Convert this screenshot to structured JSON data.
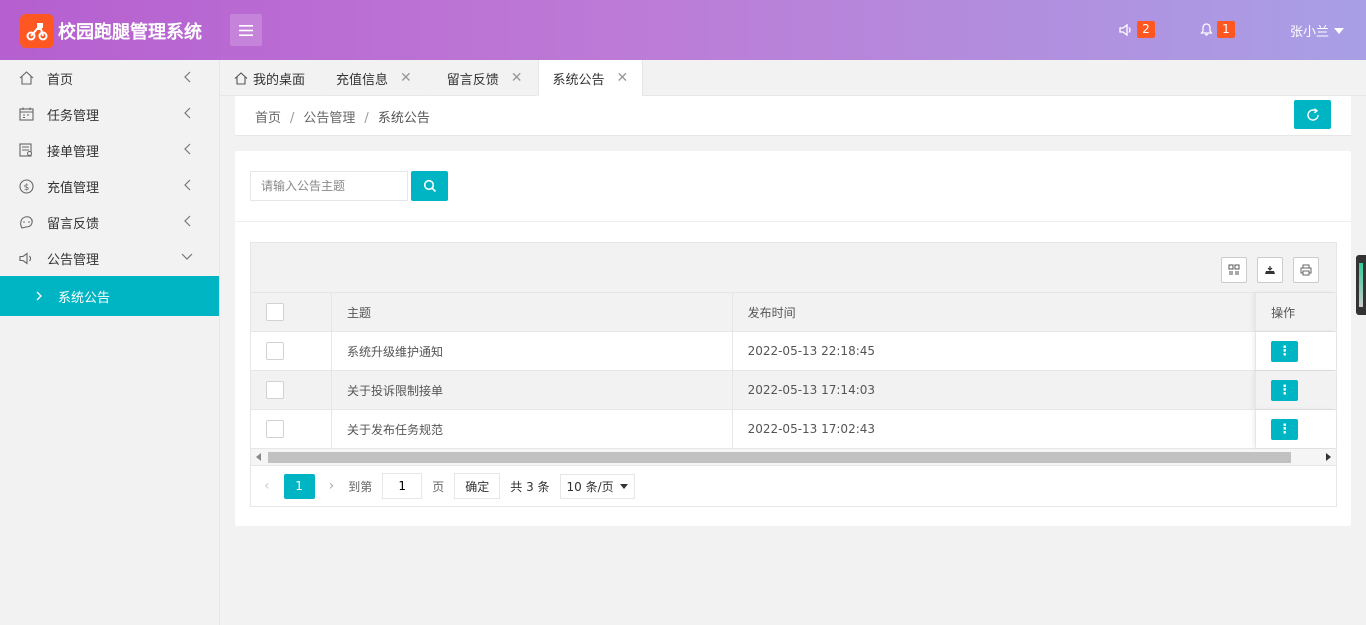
{
  "app": {
    "title": "校园跑腿管理系统",
    "brand_color": "#ff5722",
    "accent": "#00b5c3"
  },
  "header": {
    "notice_count": "2",
    "bell_count": "1",
    "user_name": "张小兰"
  },
  "sidebar": {
    "items": [
      {
        "label": "首页",
        "icon": "home-icon"
      },
      {
        "label": "任务管理",
        "icon": "calendar-icon"
      },
      {
        "label": "接单管理",
        "icon": "order-icon"
      },
      {
        "label": "充值管理",
        "icon": "dollar-icon"
      },
      {
        "label": "留言反馈",
        "icon": "message-icon"
      },
      {
        "label": "公告管理",
        "icon": "speaker-icon"
      }
    ],
    "active_sub": "系统公告"
  },
  "tabs": [
    {
      "label": "我的桌面"
    },
    {
      "label": "充值信息"
    },
    {
      "label": "留言反馈"
    },
    {
      "label": "系统公告"
    }
  ],
  "breadcrumb": [
    "首页",
    "公告管理",
    "系统公告"
  ],
  "search": {
    "placeholder": "请输入公告主题",
    "value": ""
  },
  "table": {
    "headers": {
      "subject": "主题",
      "time": "发布时间",
      "op": "操作"
    },
    "rows": [
      {
        "subject": "系统升级维护通知",
        "time": "2022-05-13 22:18:45"
      },
      {
        "subject": "关于投诉限制接单",
        "time": "2022-05-13 17:14:03"
      },
      {
        "subject": "关于发布任务规范",
        "time": "2022-05-13 17:02:43"
      }
    ]
  },
  "pager": {
    "current": "1",
    "goto_label": "到第",
    "goto_value": "1",
    "page_label": "页",
    "confirm": "确定",
    "total": "共 3 条",
    "page_size": "10 条/页"
  }
}
